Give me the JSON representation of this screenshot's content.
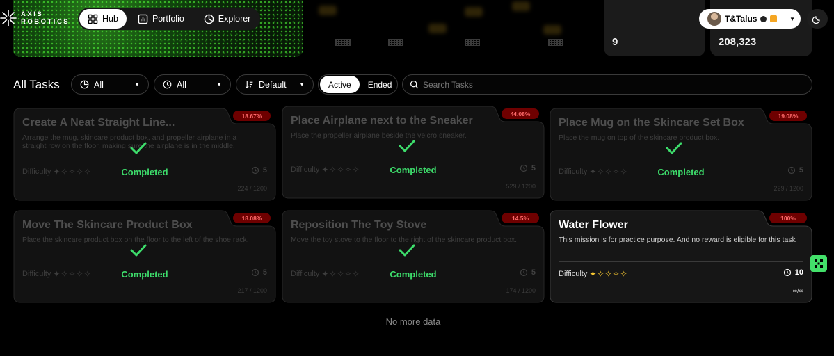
{
  "brand": {
    "line1": "AXIS",
    "line2": "ROBOTICS"
  },
  "nav": [
    {
      "label": "Hub",
      "icon": "grid-icon",
      "active": true
    },
    {
      "label": "Portfolio",
      "icon": "chart-icon",
      "active": false
    },
    {
      "label": "Explorer",
      "icon": "compass-icon",
      "active": false
    }
  ],
  "stats": {
    "left_value": "9",
    "right_value": "208,323"
  },
  "user": {
    "name": "T&Talus"
  },
  "filters": {
    "title": "All Tasks",
    "category": "All",
    "time": "All",
    "sort": "Default",
    "status_tabs": [
      {
        "label": "Active",
        "active": true
      },
      {
        "label": "Ended",
        "active": false
      }
    ],
    "search_placeholder": "Search Tasks"
  },
  "colors": {
    "completed": "#3ddc6b",
    "percent_bg": "#6e0000",
    "percent_text": "#ff6b6b",
    "star_active": "#f5c531"
  },
  "tasks": [
    {
      "title": "Create A Neat Straight Line...",
      "description": "Arrange the mug, skincare product box, and propeller airplane in a straight row on the floor, making sure the airplane is in the middle.",
      "percent": "18.67%",
      "status": "Completed",
      "difficulty_label": "Difficulty",
      "difficulty": 1,
      "time": "5",
      "progress": "224 / 1200"
    },
    {
      "title": "Place Airplane next to the Sneaker",
      "description": "Place the propeller airplane beside the velcro sneaker.",
      "percent": "44.08%",
      "status": "Completed",
      "difficulty_label": "Difficulty",
      "difficulty": 1,
      "time": "5",
      "progress": "529 / 1200"
    },
    {
      "title": "Place Mug on the Skincare Set Box",
      "description": "Place the mug on top of the skincare product box.",
      "percent": "19.08%",
      "status": "Completed",
      "difficulty_label": "Difficulty",
      "difficulty": 1,
      "time": "5",
      "progress": "229 / 1200"
    },
    {
      "title": "Move The Skincare Product Box",
      "description": "Place the skincare product box on the floor to the left of the shoe rack.",
      "percent": "18.08%",
      "status": "Completed",
      "difficulty_label": "Difficulty",
      "difficulty": 1,
      "time": "5",
      "progress": "217 / 1200"
    },
    {
      "title": "Reposition The Toy Stove",
      "description": "Move the toy stove to the floor to the right of the skincare product box.",
      "percent": "14.5%",
      "status": "Completed",
      "difficulty_label": "Difficulty",
      "difficulty": 1,
      "time": "5",
      "progress": "174 / 1200"
    },
    {
      "title": "Water Flower",
      "description": "This mission is for practice purpose. And no reward is eligible for this task",
      "percent": "100%",
      "status": "",
      "difficulty_label": "Difficulty",
      "difficulty": 1,
      "time": "10",
      "progress": "∞/∞"
    }
  ],
  "footer": {
    "no_more": "No more data"
  }
}
